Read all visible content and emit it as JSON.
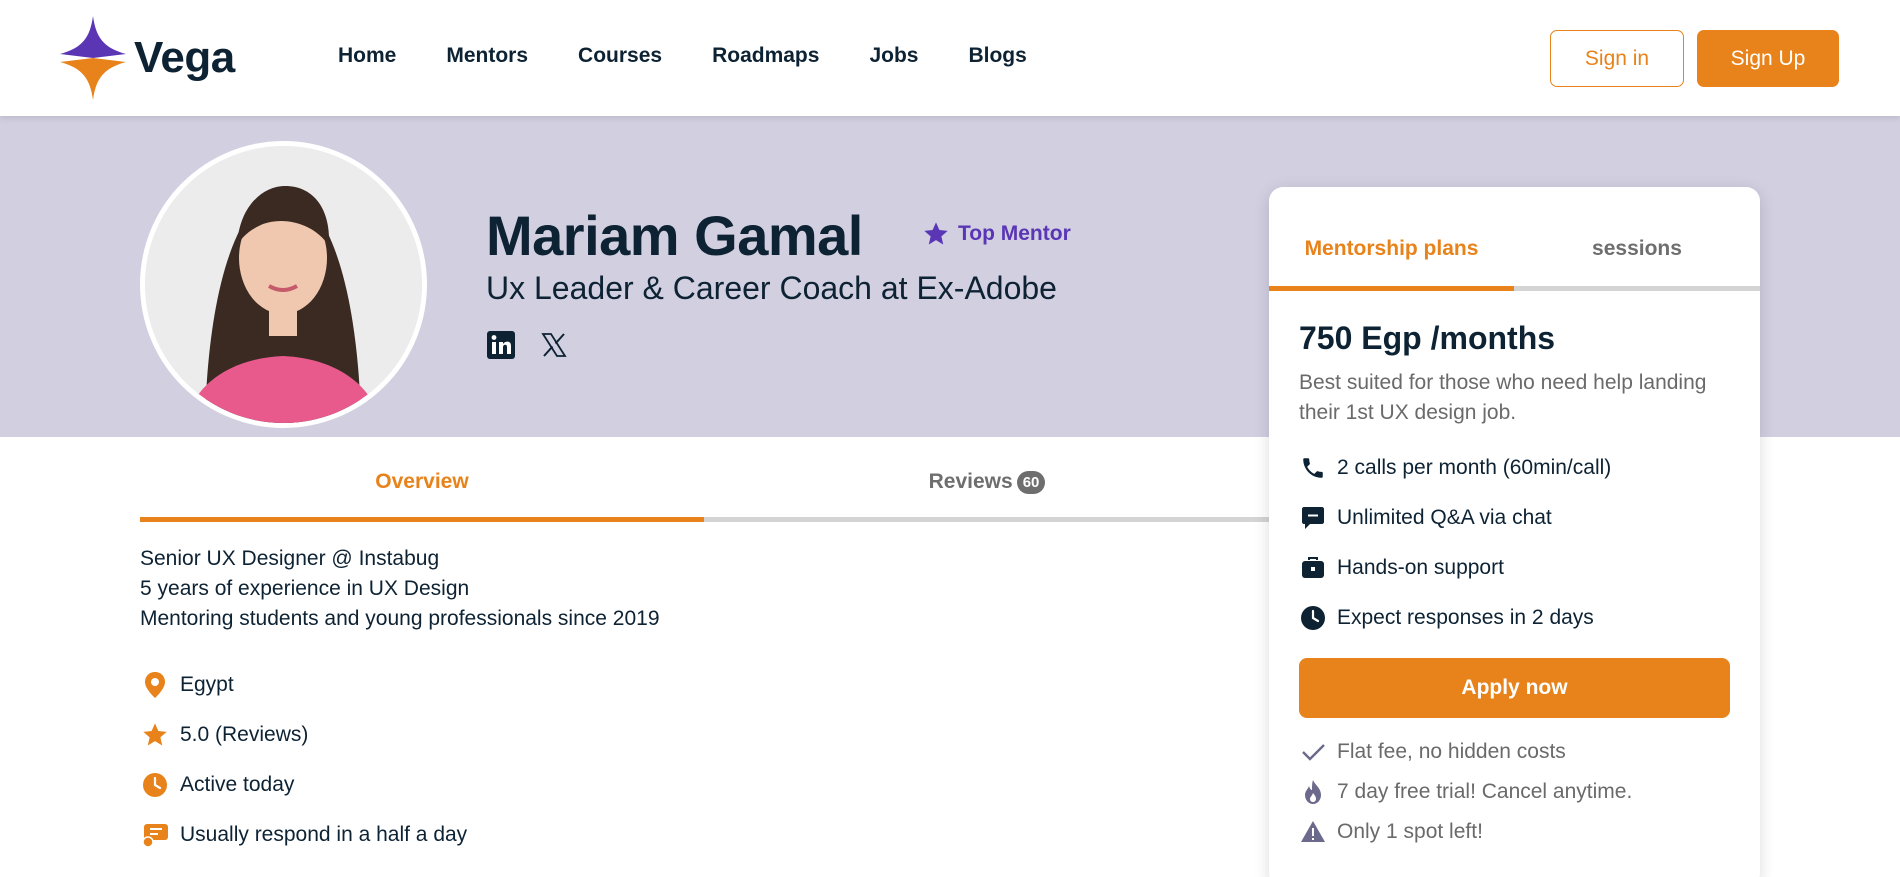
{
  "brand": {
    "name": "Vega",
    "accent": "#e8821a",
    "purple": "#5a36b5",
    "hero_bg": "#d1cfe0"
  },
  "nav": {
    "items": [
      "Home",
      "Mentors",
      "Courses",
      "Roadmaps",
      "Jobs",
      "Blogs"
    ]
  },
  "auth": {
    "signin": "Sign in",
    "signup": "Sign Up"
  },
  "profile": {
    "name": "Mariam Gamal",
    "badge": "Top Mentor",
    "headline": "Ux Leader & Career Coach at Ex-Adobe",
    "social": [
      "linkedin-icon",
      "x-icon"
    ]
  },
  "tabs": {
    "overview": "Overview",
    "reviews": "Reviews",
    "reviews_count": "60"
  },
  "overview": {
    "bio": [
      "Senior UX Designer @ Instabug",
      "5 years of experience in UX Design",
      "Mentoring students and young professionals since 2019"
    ],
    "facts": [
      {
        "icon": "location-pin-icon",
        "text": "Egypt"
      },
      {
        "icon": "star-icon",
        "text": "5.0 (Reviews)"
      },
      {
        "icon": "clock-icon",
        "text": "Active today"
      },
      {
        "icon": "chat-reply-icon",
        "text": "Usually respond in a half a day"
      }
    ]
  },
  "plan_card": {
    "tabs": {
      "plans": "Mentorship plans",
      "sessions": "sessions"
    },
    "price": "750 Egp /months",
    "description": "Best suited for those who need help landing their 1st UX design job.",
    "features": [
      {
        "icon": "phone-icon",
        "text": "2 calls per month (60min/call)"
      },
      {
        "icon": "chat-icon",
        "text": "Unlimited Q&A via chat"
      },
      {
        "icon": "briefcase-icon",
        "text": "Hands-on support"
      },
      {
        "icon": "clock-icon",
        "text": "Expect responses in 2 days"
      }
    ],
    "apply": "Apply now",
    "perks": [
      {
        "icon": "check-icon",
        "text": "Flat fee, no hidden costs"
      },
      {
        "icon": "flame-icon",
        "text": "7 day free trial! Cancel anytime."
      },
      {
        "icon": "warning-icon",
        "text": "Only 1 spot left!"
      }
    ]
  }
}
